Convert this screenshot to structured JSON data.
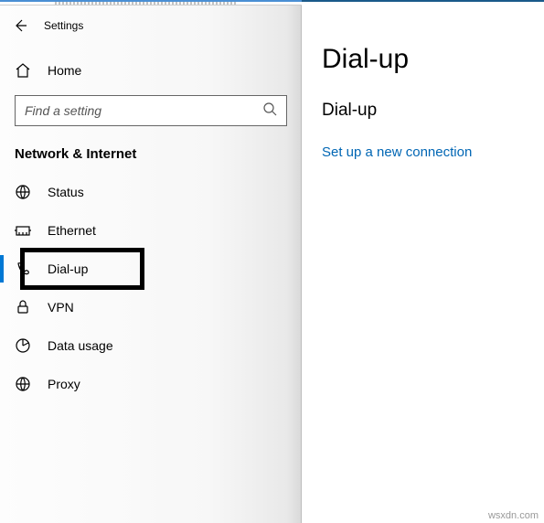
{
  "header": {
    "settings_label": "Settings"
  },
  "home": {
    "label": "Home"
  },
  "search": {
    "placeholder": "Find a setting"
  },
  "category": {
    "title": "Network & Internet"
  },
  "nav": {
    "items": [
      {
        "label": "Status"
      },
      {
        "label": "Ethernet"
      },
      {
        "label": "Dial-up"
      },
      {
        "label": "VPN"
      },
      {
        "label": "Data usage"
      },
      {
        "label": "Proxy"
      }
    ]
  },
  "main": {
    "title": "Dial-up",
    "section": "Dial-up",
    "link": "Set up a new connection"
  },
  "attribution": "wsxdn.com"
}
